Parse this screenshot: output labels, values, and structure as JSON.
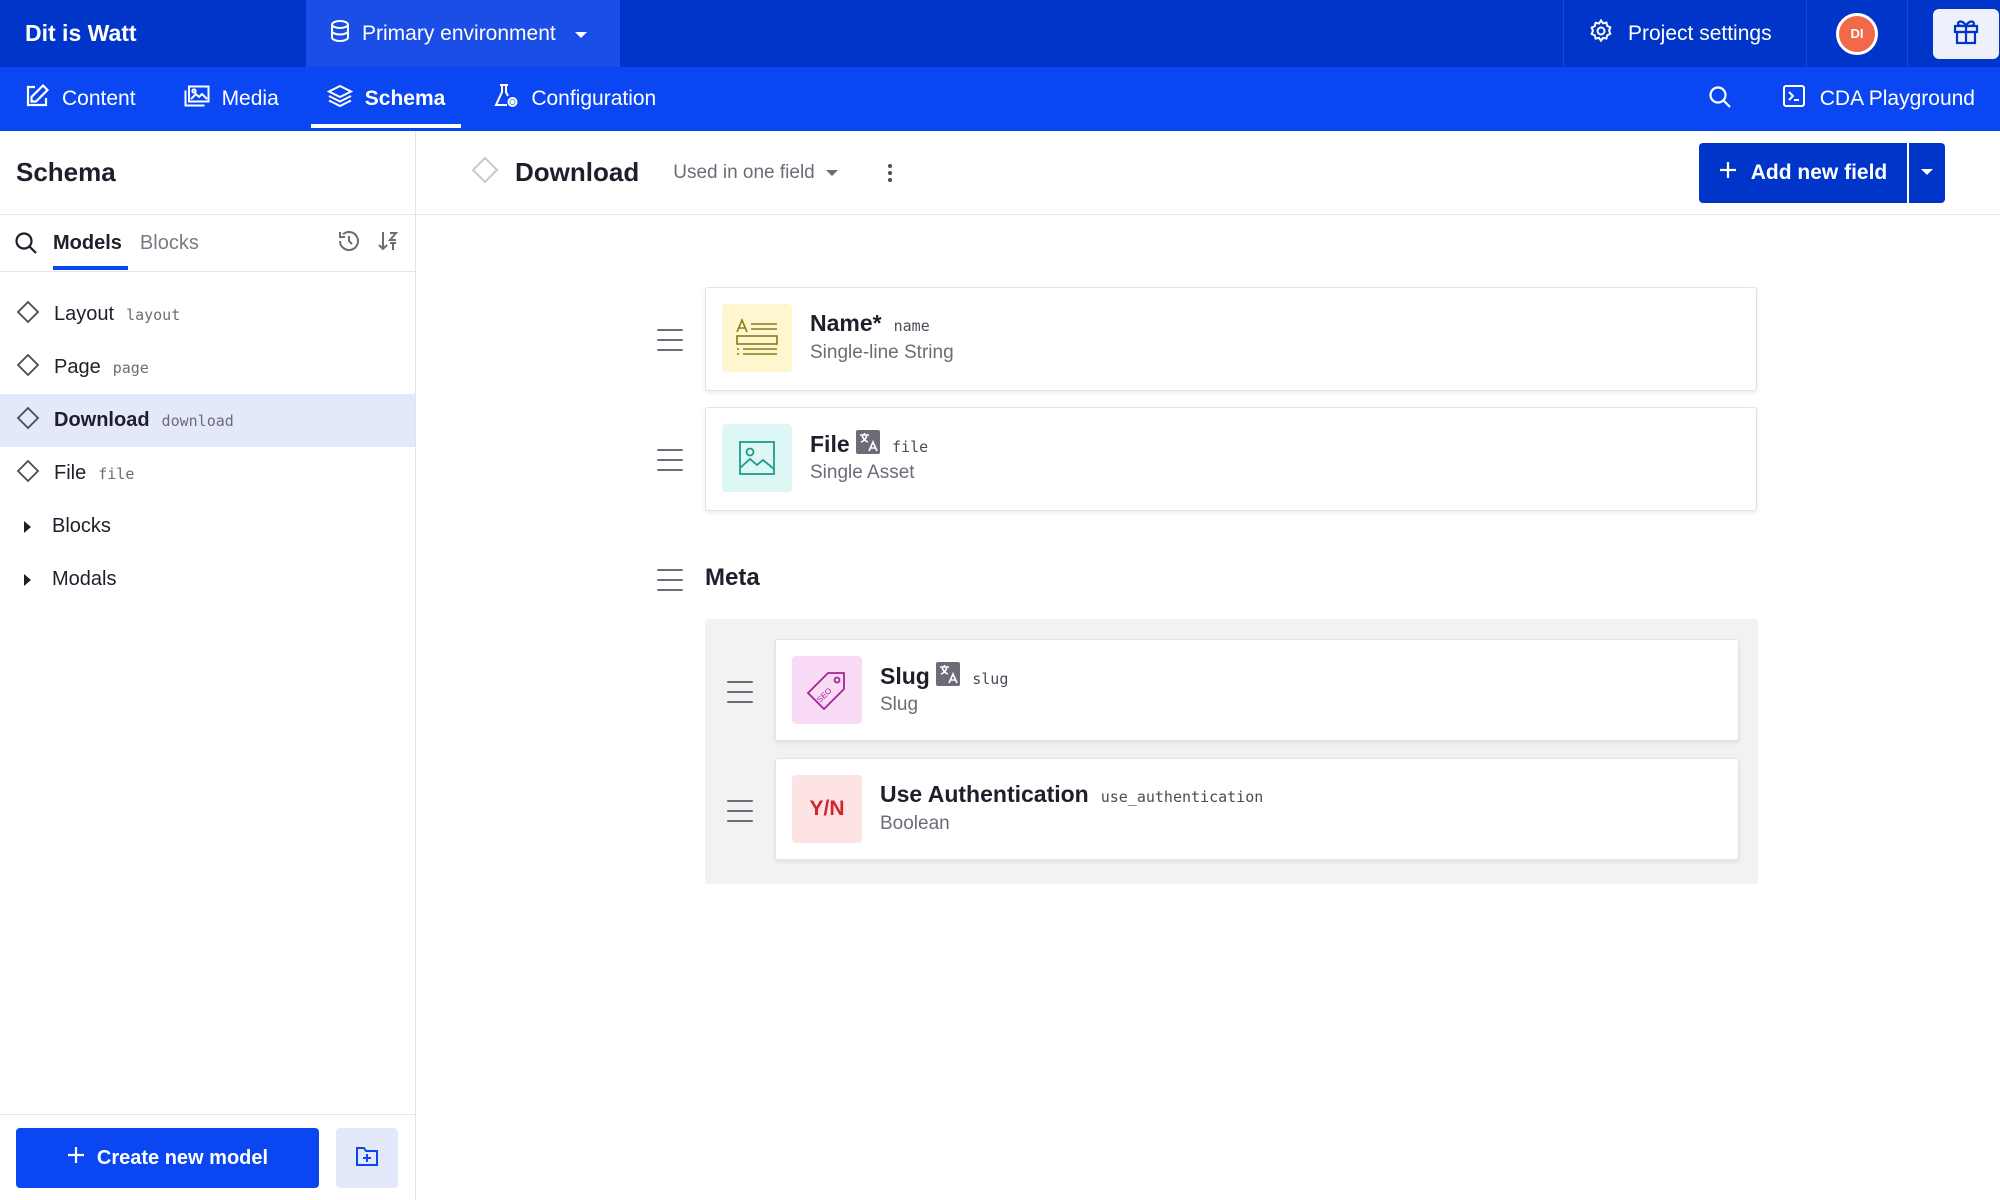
{
  "topbar": {
    "project_name": "Dit is Watt",
    "environment": "Primary environment",
    "project_settings": "Project settings",
    "avatar_initials": "DI"
  },
  "nav": {
    "tabs": [
      {
        "label": "Content",
        "icon": "edit-icon"
      },
      {
        "label": "Media",
        "icon": "image-icon"
      },
      {
        "label": "Schema",
        "icon": "layers-icon",
        "active": true
      },
      {
        "label": "Configuration",
        "icon": "flask-gear-icon"
      }
    ],
    "cda_playground": "CDA Playground"
  },
  "sidebar": {
    "title": "Schema",
    "tabs": {
      "models": "Models",
      "blocks": "Blocks"
    },
    "items": [
      {
        "label": "Layout",
        "api": "layout"
      },
      {
        "label": "Page",
        "api": "page"
      },
      {
        "label": "Download",
        "api": "download",
        "selected": true
      },
      {
        "label": "File",
        "api": "file"
      }
    ],
    "groups": [
      {
        "label": "Blocks"
      },
      {
        "label": "Modals"
      }
    ],
    "create_button": "Create new model"
  },
  "main": {
    "title": "Download",
    "usage": "Used in one field",
    "add_field": "Add new field",
    "fields": [
      {
        "label": "Name*",
        "api": "name",
        "type": "Single-line String",
        "icon": "text-field-icon",
        "localized": false
      },
      {
        "label": "File",
        "api": "file",
        "type": "Single Asset",
        "icon": "image-icon",
        "localized": true
      }
    ],
    "fieldset": {
      "title": "Meta",
      "fields": [
        {
          "label": "Slug",
          "api": "slug",
          "type": "Slug",
          "icon": "seo-tag-icon",
          "localized": true
        },
        {
          "label": "Use Authentication",
          "api": "use_authentication",
          "type": "Boolean",
          "icon_text": "Y/N",
          "localized": false
        }
      ]
    }
  },
  "colors": {
    "topbar": "#0035c9",
    "navbar": "#0a47f2",
    "environment": "#1a4ee6",
    "selected_row": "#e4e8fb",
    "text_icon_bg": "#fdf6cf",
    "asset_icon_bg": "#dcf7f4",
    "seo_icon_bg": "#f9dbf6",
    "boolean_icon_bg": "#fde3e3"
  }
}
